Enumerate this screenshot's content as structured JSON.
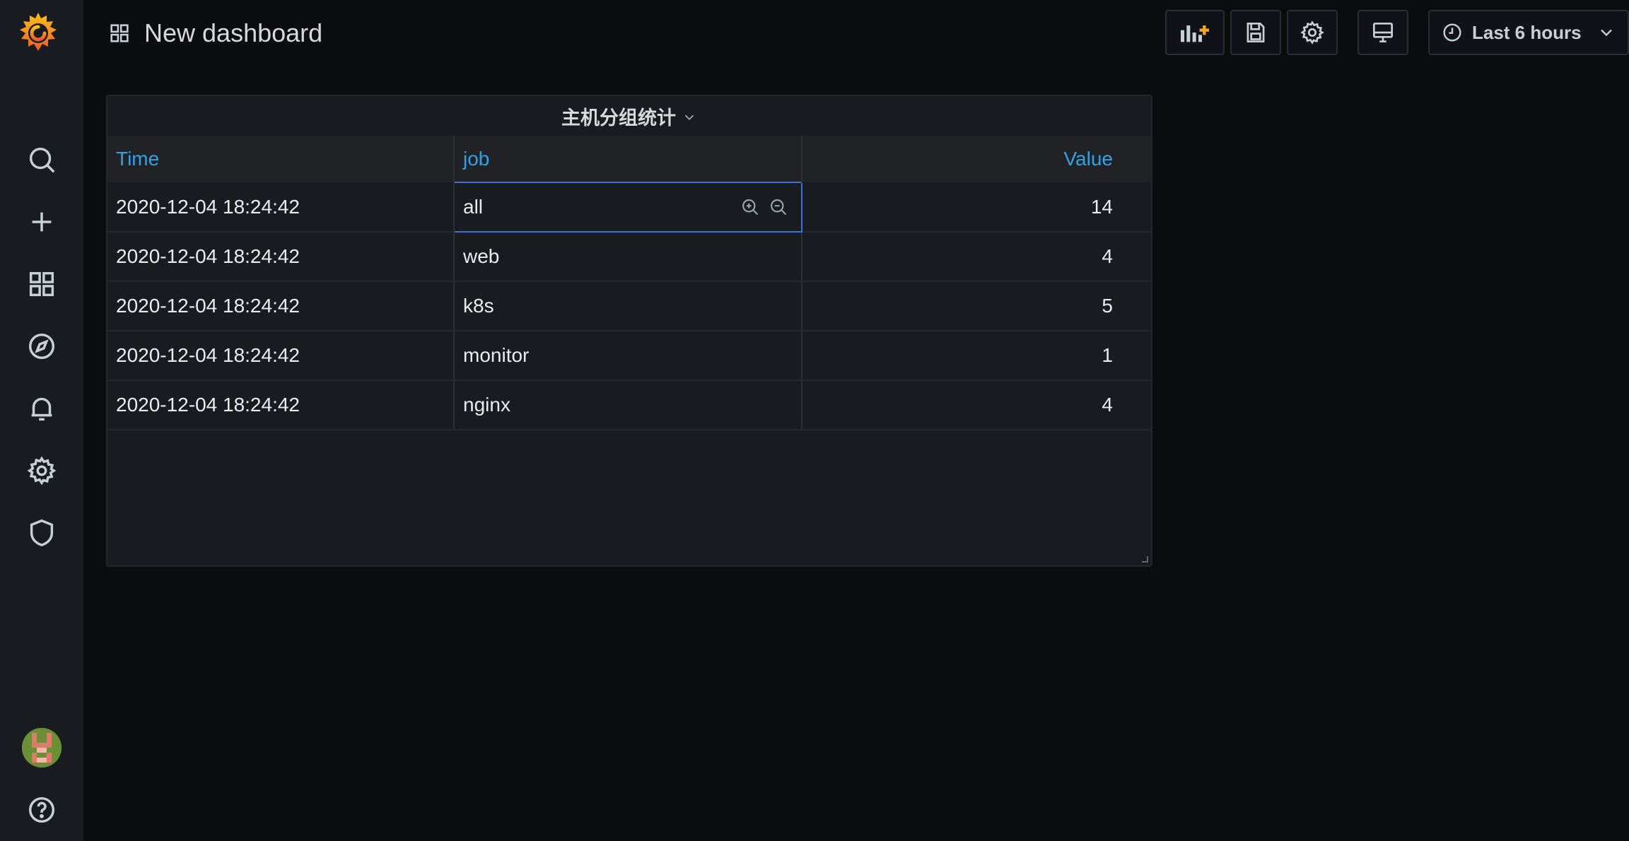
{
  "header": {
    "title": "New dashboard",
    "time_range": "Last 6 hours"
  },
  "panel": {
    "title": "主机分组统计",
    "columns": [
      "Time",
      "job",
      "Value"
    ],
    "rows": [
      [
        "2020-12-04 18:24:42",
        "all",
        "14"
      ],
      [
        "2020-12-04 18:24:42",
        "web",
        "4"
      ],
      [
        "2020-12-04 18:24:42",
        "k8s",
        "5"
      ],
      [
        "2020-12-04 18:24:42",
        "monitor",
        "1"
      ],
      [
        "2020-12-04 18:24:42",
        "nginx",
        "4"
      ]
    ]
  },
  "sidebar": {
    "items": [
      "search-icon",
      "plus-icon",
      "dashboards-icon",
      "explore-icon",
      "alerting-icon",
      "settings-icon",
      "shield-icon"
    ],
    "bottom": [
      "avatar",
      "help-icon"
    ]
  },
  "colors": {
    "accent": "#33a2e5",
    "background": "#0b0c0e",
    "panel": "#181b1f",
    "logo": "#f46800"
  }
}
